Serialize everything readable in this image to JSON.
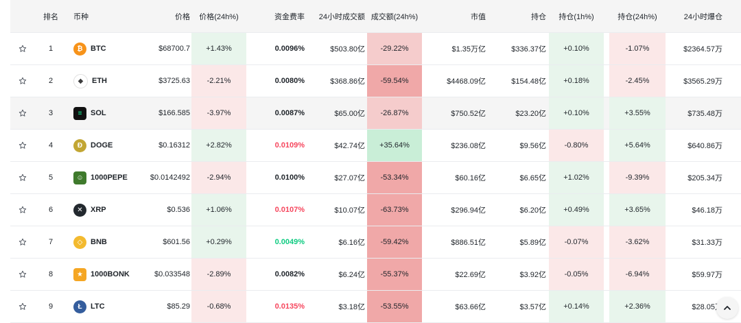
{
  "headers": {
    "rank": "排名",
    "coin": "币种",
    "price": "价格",
    "price_change": "价格(24h%)",
    "funding_rate": "资金费率",
    "volume_24h": "24小时成交额",
    "volume_change": "成交额(24h%)",
    "market_cap": "市值",
    "open_interest": "持仓",
    "oi_1h": "持仓(1h%)",
    "oi_24h": "持仓(24h%)",
    "liquidations_24h": "24小时爆仓"
  },
  "colors": {
    "green_bg": "#e6f4ea",
    "red_bg_light": "#fbe9e9",
    "red_bg_mid": "#f5c9c9",
    "red_bg_strong": "#f0a8a8",
    "green_text": "#0ecb81",
    "red_text": "#f6465d"
  },
  "rows": [
    {
      "rank": "1",
      "coin": "BTC",
      "icon": "btc-icon",
      "price": "$68700.7",
      "price_change": "+1.43%",
      "funding_rate": "0.0096%",
      "volume_24h": "$503.80亿",
      "volume_change": "-29.22%",
      "market_cap": "$1.35万亿",
      "open_interest": "$336.37亿",
      "oi_1h": "+0.10%",
      "oi_24h": "-1.07%",
      "liquidations_24h": "$2364.57万"
    },
    {
      "rank": "2",
      "coin": "ETH",
      "icon": "eth-icon",
      "price": "$3725.63",
      "price_change": "-2.21%",
      "funding_rate": "0.0080%",
      "volume_24h": "$368.86亿",
      "volume_change": "-59.54%",
      "market_cap": "$4468.09亿",
      "open_interest": "$154.48亿",
      "oi_1h": "+0.18%",
      "oi_24h": "-2.45%",
      "liquidations_24h": "$3565.29万"
    },
    {
      "rank": "3",
      "coin": "SOL",
      "icon": "sol-icon",
      "price": "$166.585",
      "price_change": "-3.97%",
      "funding_rate": "0.0087%",
      "volume_24h": "$65.00亿",
      "volume_change": "-26.87%",
      "market_cap": "$750.52亿",
      "open_interest": "$23.20亿",
      "oi_1h": "+0.10%",
      "oi_24h": "+3.55%",
      "liquidations_24h": "$735.48万"
    },
    {
      "rank": "4",
      "coin": "DOGE",
      "icon": "doge-icon",
      "price": "$0.16312",
      "price_change": "+2.82%",
      "funding_rate": "0.0109%",
      "volume_24h": "$42.74亿",
      "volume_change": "+35.64%",
      "market_cap": "$236.08亿",
      "open_interest": "$9.56亿",
      "oi_1h": "-0.80%",
      "oi_24h": "+5.64%",
      "liquidations_24h": "$640.86万"
    },
    {
      "rank": "5",
      "coin": "1000PEPE",
      "icon": "pepe-icon",
      "price": "$0.0142492",
      "price_change": "-2.94%",
      "funding_rate": "0.0100%",
      "volume_24h": "$27.07亿",
      "volume_change": "-53.34%",
      "market_cap": "$60.16亿",
      "open_interest": "$6.65亿",
      "oi_1h": "+1.02%",
      "oi_24h": "-9.39%",
      "liquidations_24h": "$205.34万"
    },
    {
      "rank": "6",
      "coin": "XRP",
      "icon": "xrp-icon",
      "price": "$0.536",
      "price_change": "+1.06%",
      "funding_rate": "0.0107%",
      "volume_24h": "$10.07亿",
      "volume_change": "-63.73%",
      "market_cap": "$296.94亿",
      "open_interest": "$6.20亿",
      "oi_1h": "+0.49%",
      "oi_24h": "+3.65%",
      "liquidations_24h": "$46.18万"
    },
    {
      "rank": "7",
      "coin": "BNB",
      "icon": "bnb-icon",
      "price": "$601.56",
      "price_change": "+0.29%",
      "funding_rate": "0.0049%",
      "volume_24h": "$6.16亿",
      "volume_change": "-59.42%",
      "market_cap": "$886.51亿",
      "open_interest": "$5.89亿",
      "oi_1h": "-0.07%",
      "oi_24h": "-3.62%",
      "liquidations_24h": "$31.33万"
    },
    {
      "rank": "8",
      "coin": "1000BONK",
      "icon": "bonk-icon",
      "price": "$0.033548",
      "price_change": "-2.89%",
      "funding_rate": "0.0082%",
      "volume_24h": "$6.24亿",
      "volume_change": "-55.37%",
      "market_cap": "$22.69亿",
      "open_interest": "$3.92亿",
      "oi_1h": "-0.05%",
      "oi_24h": "-6.94%",
      "liquidations_24h": "$59.97万"
    },
    {
      "rank": "9",
      "coin": "LTC",
      "icon": "ltc-icon",
      "price": "$85.29",
      "price_change": "-0.68%",
      "funding_rate": "0.0135%",
      "volume_24h": "$3.18亿",
      "volume_change": "-53.55%",
      "market_cap": "$63.66亿",
      "open_interest": "$3.57亿",
      "oi_1h": "+0.14%",
      "oi_24h": "+2.36%",
      "liquidations_24h": "$28.05万"
    }
  ],
  "scroll_top_icon": "chevron-up-icon"
}
